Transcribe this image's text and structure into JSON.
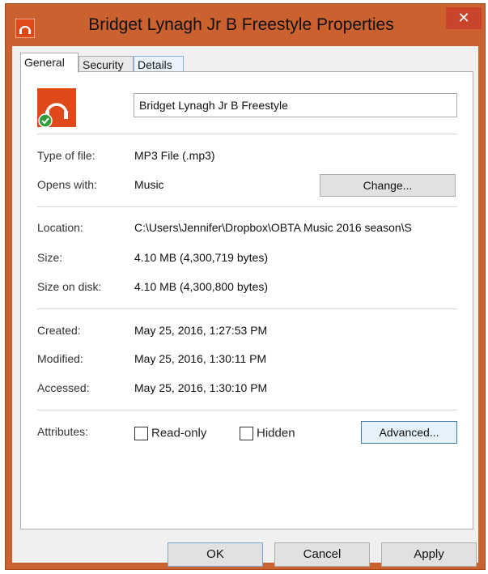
{
  "window": {
    "title": "Bridget Lynagh Jr B Freestyle Properties",
    "close_label": "✕",
    "accent_color": "#cc6130"
  },
  "tabs": [
    {
      "label": "General",
      "active": true
    },
    {
      "label": "Security",
      "active": false
    },
    {
      "label": "Details",
      "active": false
    }
  ],
  "file": {
    "icon": "music-app-icon",
    "name": "Bridget Lynagh Jr B Freestyle"
  },
  "type": {
    "label": "Type of file:",
    "value": "MP3 File (.mp3)"
  },
  "opens_with": {
    "label": "Opens with:",
    "value": "Music",
    "button": "Change..."
  },
  "location": {
    "label": "Location:",
    "value": "C:\\Users\\Jennifer\\Dropbox\\OBTA Music 2016 season\\S"
  },
  "size": {
    "label": "Size:",
    "value": "4.10 MB (4,300,719 bytes)"
  },
  "size_on_disk": {
    "label": "Size on disk:",
    "value": "4.10 MB (4,300,800 bytes)"
  },
  "created": {
    "label": "Created:",
    "value": "May 25, 2016, 1:27:53 PM"
  },
  "modified": {
    "label": "Modified:",
    "value": "May 25, 2016, 1:30:11 PM"
  },
  "accessed": {
    "label": "Accessed:",
    "value": "May 25, 2016, 1:30:10 PM"
  },
  "attributes": {
    "label": "Attributes:",
    "readonly_label": "Read-only",
    "readonly_checked": false,
    "hidden_label": "Hidden",
    "hidden_checked": false,
    "advanced_button": "Advanced..."
  },
  "footer": {
    "ok": "OK",
    "cancel": "Cancel",
    "apply": "Apply"
  }
}
